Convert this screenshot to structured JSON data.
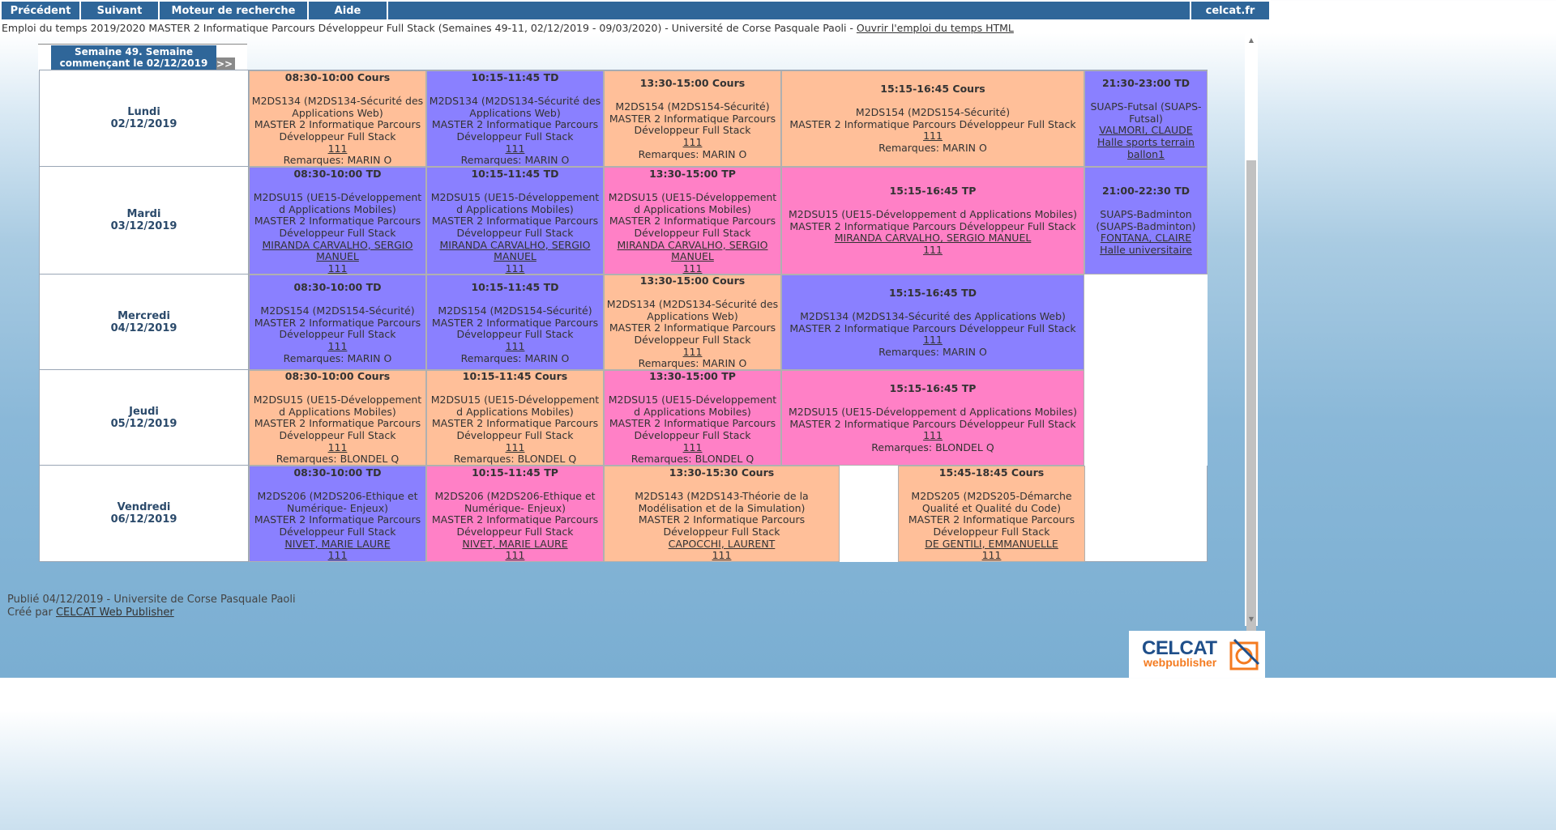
{
  "toolbar": {
    "prev": "Précédent",
    "next": "Suivant",
    "search": "Moteur de recherche",
    "help": "Aide",
    "site": "celcat.fr"
  },
  "subtitle": {
    "text": "Emploi du temps 2019/2020 MASTER 2 Informatique Parcours Développeur Full Stack (Semaines 49-11, 02/12/2019 - 09/03/2020) - Université de Corse Pasquale Paoli - ",
    "link": "Ouvrir l'emploi du temps HTML"
  },
  "week": {
    "prev": "<<",
    "next": ">>",
    "label": "Semaine 49. Semaine commençant le 02/12/2019"
  },
  "days": [
    {
      "name": "Lundi",
      "date": "02/12/2019"
    },
    {
      "name": "Mardi",
      "date": "03/12/2019"
    },
    {
      "name": "Mercredi",
      "date": "04/12/2019"
    },
    {
      "name": "Jeudi",
      "date": "05/12/2019"
    },
    {
      "name": "Vendredi",
      "date": "06/12/2019"
    }
  ],
  "colors": {
    "cours": "#ffbf99",
    "td": "#8a80ff",
    "tp": "#ff80c6",
    "toolbar": "#2f6699"
  },
  "events": [
    [
      {
        "time": "08:30-10:00 Cours",
        "kind": "cours",
        "course": "M2DS134 (M2DS134-Sécurité des Applications Web)",
        "group": "MASTER 2 Informatique Parcours Développeur Full Stack",
        "room": "111",
        "note": "Remarques: MARIN O"
      },
      {
        "time": "10:15-11:45 TD",
        "kind": "td",
        "course": "M2DS134 (M2DS134-Sécurité des Applications Web)",
        "group": "MASTER 2 Informatique Parcours Développeur Full Stack",
        "room": "111",
        "note": "Remarques: MARIN O"
      },
      {
        "time": "13:30-15:00 Cours",
        "kind": "cours",
        "course": "M2DS154 (M2DS154-Sécurité)",
        "group": "MASTER 2 Informatique Parcours Développeur Full Stack",
        "room": "111",
        "note": "Remarques: MARIN O"
      },
      {
        "time": "15:15-16:45 Cours",
        "kind": "cours",
        "course": "M2DS154 (M2DS154-Sécurité)",
        "group": "MASTER 2 Informatique Parcours Développeur Full Stack",
        "room": "111",
        "note": "Remarques: MARIN O"
      },
      {
        "time": "21:30-23:00 TD",
        "kind": "td",
        "course": "SUAPS-Futsal (SUAPS-Futsal)",
        "staff": "VALMORI, CLAUDE",
        "room": "Halle sports terrain ballon1"
      }
    ],
    [
      {
        "time": "08:30-10:00 TD",
        "kind": "td",
        "course": "M2DSU15 (UE15-Développement d Applications Mobiles)",
        "group": "MASTER 2 Informatique Parcours Développeur Full Stack",
        "staff": "MIRANDA CARVALHO, SERGIO MANUEL",
        "room": "111"
      },
      {
        "time": "10:15-11:45 TD",
        "kind": "td",
        "course": "M2DSU15 (UE15-Développement d Applications Mobiles)",
        "group": "MASTER 2 Informatique Parcours Développeur Full Stack",
        "staff": "MIRANDA CARVALHO, SERGIO MANUEL",
        "room": "111"
      },
      {
        "time": "13:30-15:00 TP",
        "kind": "tp",
        "course": "M2DSU15 (UE15-Développement d Applications Mobiles)",
        "group": "MASTER 2 Informatique Parcours Développeur Full Stack",
        "staff": "MIRANDA CARVALHO, SERGIO MANUEL",
        "room": "111"
      },
      {
        "time": "15:15-16:45 TP",
        "kind": "tp",
        "course": "M2DSU15 (UE15-Développement d Applications Mobiles)",
        "group": "MASTER 2 Informatique Parcours Développeur Full Stack",
        "staff": "MIRANDA CARVALHO, SERGIO MANUEL",
        "room": "111"
      },
      {
        "time": "21:00-22:30 TD",
        "kind": "td",
        "course": "SUAPS-Badminton (SUAPS-Badminton)",
        "staff": "FONTANA, CLAIRE",
        "room": "Halle universitaire"
      }
    ],
    [
      {
        "time": "08:30-10:00 TD",
        "kind": "td",
        "course": "M2DS154 (M2DS154-Sécurité)",
        "group": "MASTER 2 Informatique Parcours Développeur Full Stack",
        "room": "111",
        "note": "Remarques: MARIN O"
      },
      {
        "time": "10:15-11:45 TD",
        "kind": "td",
        "course": "M2DS154 (M2DS154-Sécurité)",
        "group": "MASTER 2 Informatique Parcours Développeur Full Stack",
        "room": "111",
        "note": "Remarques: MARIN O"
      },
      {
        "time": "13:30-15:00 Cours",
        "kind": "cours",
        "course": "M2DS134 (M2DS134-Sécurité des Applications Web)",
        "group": "MASTER 2 Informatique Parcours Développeur Full Stack",
        "room": "111",
        "note": "Remarques: MARIN O"
      },
      {
        "time": "15:15-16:45 TD",
        "kind": "td",
        "course": "M2DS134 (M2DS134-Sécurité des Applications Web)",
        "group": "MASTER 2 Informatique Parcours Développeur Full Stack",
        "room": "111",
        "note": "Remarques: MARIN O"
      }
    ],
    [
      {
        "time": "08:30-10:00 Cours",
        "kind": "cours",
        "course": "M2DSU15 (UE15-Développement d Applications Mobiles)",
        "group": "MASTER 2 Informatique Parcours Développeur Full Stack",
        "room": "111",
        "note": "Remarques: BLONDEL Q"
      },
      {
        "time": "10:15-11:45 Cours",
        "kind": "cours",
        "course": "M2DSU15 (UE15-Développement d Applications Mobiles)",
        "group": "MASTER 2 Informatique Parcours Développeur Full Stack",
        "room": "111",
        "note": "Remarques: BLONDEL Q"
      },
      {
        "time": "13:30-15:00 TP",
        "kind": "tp",
        "course": "M2DSU15 (UE15-Développement d Applications Mobiles)",
        "group": "MASTER 2 Informatique Parcours Développeur Full Stack",
        "room": "111",
        "note": "Remarques: BLONDEL Q"
      },
      {
        "time": "15:15-16:45 TP",
        "kind": "tp",
        "course": "M2DSU15 (UE15-Développement d Applications Mobiles)",
        "group": "MASTER 2 Informatique Parcours Développeur Full Stack",
        "room": "111",
        "note": "Remarques: BLONDEL Q"
      }
    ],
    [
      {
        "time": "08:30-10:00 TD",
        "kind": "td",
        "course": "M2DS206 (M2DS206-Ethique et Numérique- Enjeux)",
        "group": "MASTER 2 Informatique Parcours Développeur Full Stack",
        "staff": "NIVET, MARIE LAURE",
        "room": "111"
      },
      {
        "time": "10:15-11:45 TP",
        "kind": "tp",
        "course": "M2DS206 (M2DS206-Ethique et Numérique- Enjeux)",
        "group": "MASTER 2 Informatique Parcours Développeur Full Stack",
        "staff": "NIVET, MARIE LAURE",
        "room": "111"
      },
      {
        "time": "13:30-15:30 Cours",
        "kind": "cours",
        "course": "M2DS143 (M2DS143-Théorie de la Modélisation et de la Simulation)",
        "group": "MASTER 2 Informatique Parcours Développeur Full Stack",
        "staff": "CAPOCCHI, LAURENT",
        "room": "111"
      },
      {
        "time": "15:45-18:45 Cours",
        "kind": "cours",
        "course": "M2DS205 (M2DS205-Démarche Qualité et Qualité du Code)",
        "group": "MASTER 2 Informatique Parcours Développeur Full Stack",
        "staff": "DE GENTILI, EMMANUELLE",
        "room": "111"
      }
    ]
  ],
  "footer": {
    "published": "Publié 04/12/2019 - Universite de Corse Pasquale Paoli",
    "created_prefix": "Créé par ",
    "created_link": "CELCAT Web Publisher"
  },
  "logo": {
    "brand": "CELCAT",
    "product": "webpublisher"
  }
}
